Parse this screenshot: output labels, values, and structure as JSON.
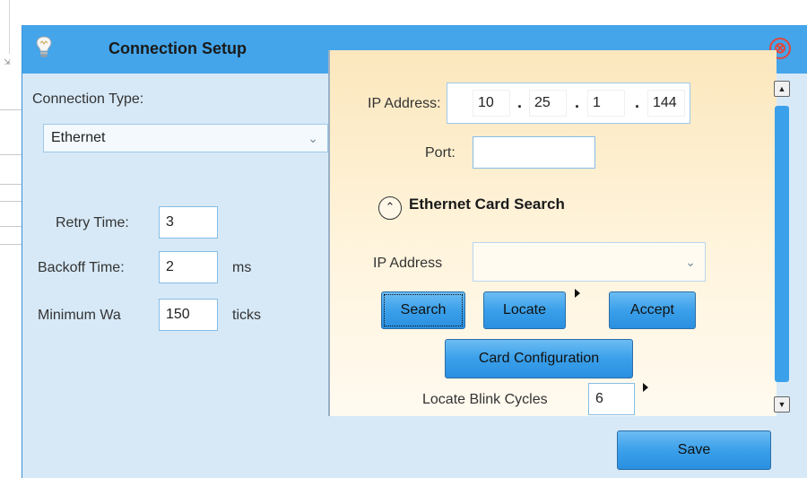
{
  "dialog": {
    "title": "Connection Setup",
    "close_glyph": "⊗"
  },
  "left": {
    "connection_type_label": "Connection Type:",
    "connection_type_value": "Ethernet",
    "retry_label": "Retry Time:",
    "retry_value": "3",
    "backoff_label": "Backoff Time:",
    "backoff_value": "2",
    "backoff_unit": "ms",
    "minimum_label": "Minimum Wa",
    "minimum_value": "150",
    "minimum_unit": "ticks"
  },
  "right": {
    "ip_label": "IP Address:",
    "ip_octets": [
      "10",
      "25",
      "1",
      "144"
    ],
    "port_label": "Port:",
    "port_value": "",
    "section_title": "Ethernet Card Search",
    "search_ip_label": "IP Address",
    "search_ip_value": "",
    "search_button": "Search",
    "locate_button": "Locate",
    "accept_button": "Accept",
    "card_config_button": "Card Configuration",
    "blink_label": "Locate Blink Cycles",
    "blink_value": "6"
  },
  "footer": {
    "save_button": "Save"
  },
  "colors": {
    "titlebar": "#44a5ea",
    "dialog_bg": "#d7e9f7",
    "accent_button": "#3aa0ea",
    "close": "#e0473e"
  },
  "icons": [
    "lightbulb-icon",
    "close-icon",
    "chevron-down-icon",
    "chevron-up-icon",
    "arrow-right-icon",
    "scroll-up-icon",
    "scroll-down-icon"
  ]
}
